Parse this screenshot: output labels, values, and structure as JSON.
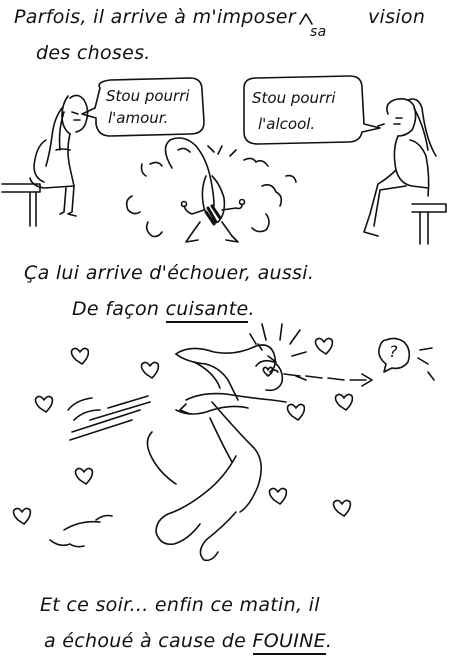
{
  "captions": {
    "line1": "Parfois, il arrive à m'imposer",
    "sa": "sa",
    "vision": "vision",
    "line2": "des choses.",
    "line3": "Ça lui arrive d'échouer, aussi.",
    "line4_prefix": "De façon",
    "line4_emph": "cuisante",
    "line4_suffix": ".",
    "line5": "Et ce soir... enfin ce matin, il",
    "line6_prefix": "a échoué à cause de",
    "line6_emph": "FOUINE",
    "line6_suffix": "."
  },
  "bubbles": {
    "left_line1": "Stou pourri",
    "left_line2": "l'amour.",
    "right_line1": "Stou pourri",
    "right_line2": "l'alcool.",
    "question": "?"
  }
}
